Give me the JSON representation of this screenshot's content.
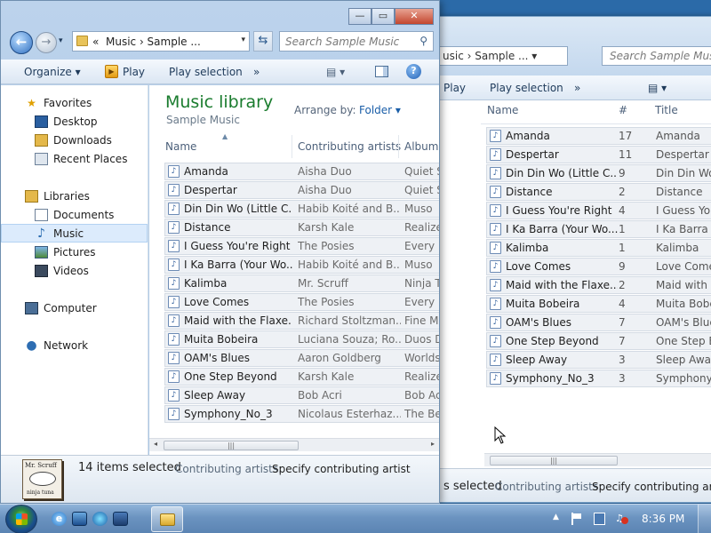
{
  "front_window": {
    "address": {
      "overflow": "«",
      "crumbs": "Music  ›  Sample ...",
      "dropdown": "▾"
    },
    "search": {
      "placeholder": "Search Sample Music"
    },
    "caption": {
      "minimize": "—",
      "maximize": "▭",
      "close": "✕"
    },
    "toolbar": {
      "organize": "Organize ▾",
      "play": "Play",
      "play_selection": "Play selection",
      "more": "»",
      "views": "▤ ▾",
      "help": "?"
    },
    "nav": {
      "favorites": "Favorites",
      "desktop": "Desktop",
      "downloads": "Downloads",
      "recent_places": "Recent Places",
      "libraries": "Libraries",
      "documents": "Documents",
      "music": "Music",
      "pictures": "Pictures",
      "videos": "Videos",
      "computer": "Computer",
      "network": "Network"
    },
    "library": {
      "title": "Music library",
      "subtitle": "Sample Music",
      "arrange_by_label": "Arrange by:",
      "arrange_by_value": "Folder ▾"
    },
    "columns": {
      "name": "Name",
      "artists": "Contributing artists",
      "album": "Album"
    },
    "rows": [
      {
        "name": "Amanda",
        "artist": "Aisha Duo",
        "album": "Quiet S"
      },
      {
        "name": "Despertar",
        "artist": "Aisha Duo",
        "album": "Quiet S"
      },
      {
        "name": "Din Din Wo (Little C...",
        "artist": "Habib Koité and B...",
        "album": "Muso"
      },
      {
        "name": "Distance",
        "artist": "Karsh Kale",
        "album": "Realize"
      },
      {
        "name": "I Guess You're Right",
        "artist": "The Posies",
        "album": "Every K"
      },
      {
        "name": "I Ka Barra (Your Wo...",
        "artist": "Habib Koité and B...",
        "album": "Muso"
      },
      {
        "name": "Kalimba",
        "artist": "Mr. Scruff",
        "album": "Ninja T"
      },
      {
        "name": "Love Comes",
        "artist": "The Posies",
        "album": "Every K"
      },
      {
        "name": "Maid with the Flaxe...",
        "artist": "Richard Stoltzman...",
        "album": "Fine M"
      },
      {
        "name": "Muita Bobeira",
        "artist": "Luciana Souza; Ro...",
        "album": "Duos D"
      },
      {
        "name": "OAM's Blues",
        "artist": "Aaron Goldberg",
        "album": "Worlds"
      },
      {
        "name": "One Step Beyond",
        "artist": "Karsh Kale",
        "album": "Realize"
      },
      {
        "name": "Sleep Away",
        "artist": "Bob Acri",
        "album": "Bob Ac"
      },
      {
        "name": "Symphony_No_3",
        "artist": "Nicolaus Esterhaz...",
        "album": "The Be"
      }
    ],
    "scroll": {
      "left": "◂",
      "right": "▸",
      "grip": "|||"
    },
    "details": {
      "thumb_line1": "Mr. Scruff",
      "thumb_line2": "ninja tuna",
      "selection": "14 items selected",
      "contrib_label": "Contributing artists:",
      "contrib_value": "Specify contributing artist"
    }
  },
  "back_window": {
    "address": "usic  ›  Sample ...  ▾",
    "search": "Search Sample Music",
    "toolbar": {
      "play": "Play",
      "play_selection": "Play selection",
      "more": "»",
      "views": "▤ ▾"
    },
    "columns": {
      "name": "Name",
      "number": "#",
      "title": "Title"
    },
    "rows": [
      {
        "name": "Amanda",
        "num": "17",
        "title": "Amanda"
      },
      {
        "name": "Despertar",
        "num": "11",
        "title": "Despertar"
      },
      {
        "name": "Din Din Wo (Little C...",
        "num": "9",
        "title": "Din Din Wo"
      },
      {
        "name": "Distance",
        "num": "2",
        "title": "Distance"
      },
      {
        "name": "I Guess You're Right",
        "num": "4",
        "title": "I Guess You'"
      },
      {
        "name": "I Ka Barra (Your Wo...",
        "num": "1",
        "title": "I Ka Barra"
      },
      {
        "name": "Kalimba",
        "num": "1",
        "title": "Kalimba"
      },
      {
        "name": "Love Comes",
        "num": "9",
        "title": "Love Comes"
      },
      {
        "name": "Maid with the Flaxe...",
        "num": "2",
        "title": "Maid with t"
      },
      {
        "name": "Muita Bobeira",
        "num": "4",
        "title": "Muita Bobei"
      },
      {
        "name": "OAM's Blues",
        "num": "7",
        "title": "OAM's Blues"
      },
      {
        "name": "One Step Beyond",
        "num": "7",
        "title": "One Step Be"
      },
      {
        "name": "Sleep Away",
        "num": "3",
        "title": "Sleep Away"
      },
      {
        "name": "Symphony_No_3",
        "num": "3",
        "title": "Symphony N"
      }
    ],
    "details": {
      "selection": "s selected",
      "contrib_label": "Contributing artists:",
      "contrib_value": "Specify contributing artist"
    },
    "scroll_grip": "|||"
  },
  "taskbar": {
    "clock": "8:36 PM",
    "tray_expand": "▲",
    "ie_letter": "e"
  }
}
